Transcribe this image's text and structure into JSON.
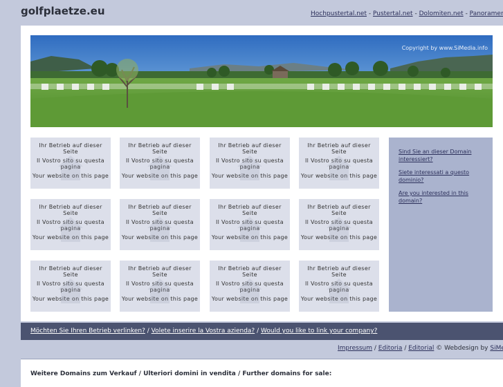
{
  "site": {
    "title": "golfplaetze.eu"
  },
  "top_links": [
    {
      "label": "Hochpustertal.net"
    },
    {
      "label": "Pustertal.net"
    },
    {
      "label": "Dolomiten.net"
    },
    {
      "label": "Panoramen.org"
    }
  ],
  "panorama": {
    "copyright": "Copyright by www.SiMedia.info"
  },
  "boxes": {
    "line1": "Ihr Betrieb auf dieser Seite",
    "line2": "Il Vostro sito su questa pagina",
    "line3": "Your website on this page"
  },
  "side": {
    "link1": "Sind Sie an dieser Domain interessiert?",
    "link2": "Siete interessati a questo dominio?",
    "link3": "Are you interested in this domain?"
  },
  "bottom_bar": {
    "link1": "Möchten Sie Ihren Betrieb verlinken?",
    "link2": "Volete inserire la Vostra azienda?",
    "link3": "Would you like to link your company?",
    "sep": " / "
  },
  "footer": {
    "impressum": "Impressum",
    "editoria": "Editoria",
    "editorial": "Editorial",
    "credit_prefix": "© Webdesign by ",
    "simedia": "SiMedia",
    "sep": " / "
  },
  "more_domains": {
    "title": "Weitere Domains zum Verkauf / Ulteriori domini in vendita / Further domains for sale:"
  },
  "colors": {
    "background": "#c3c9dc",
    "bar": "#4b5370",
    "box": "#dcdfea",
    "side": "#aab3ce"
  }
}
